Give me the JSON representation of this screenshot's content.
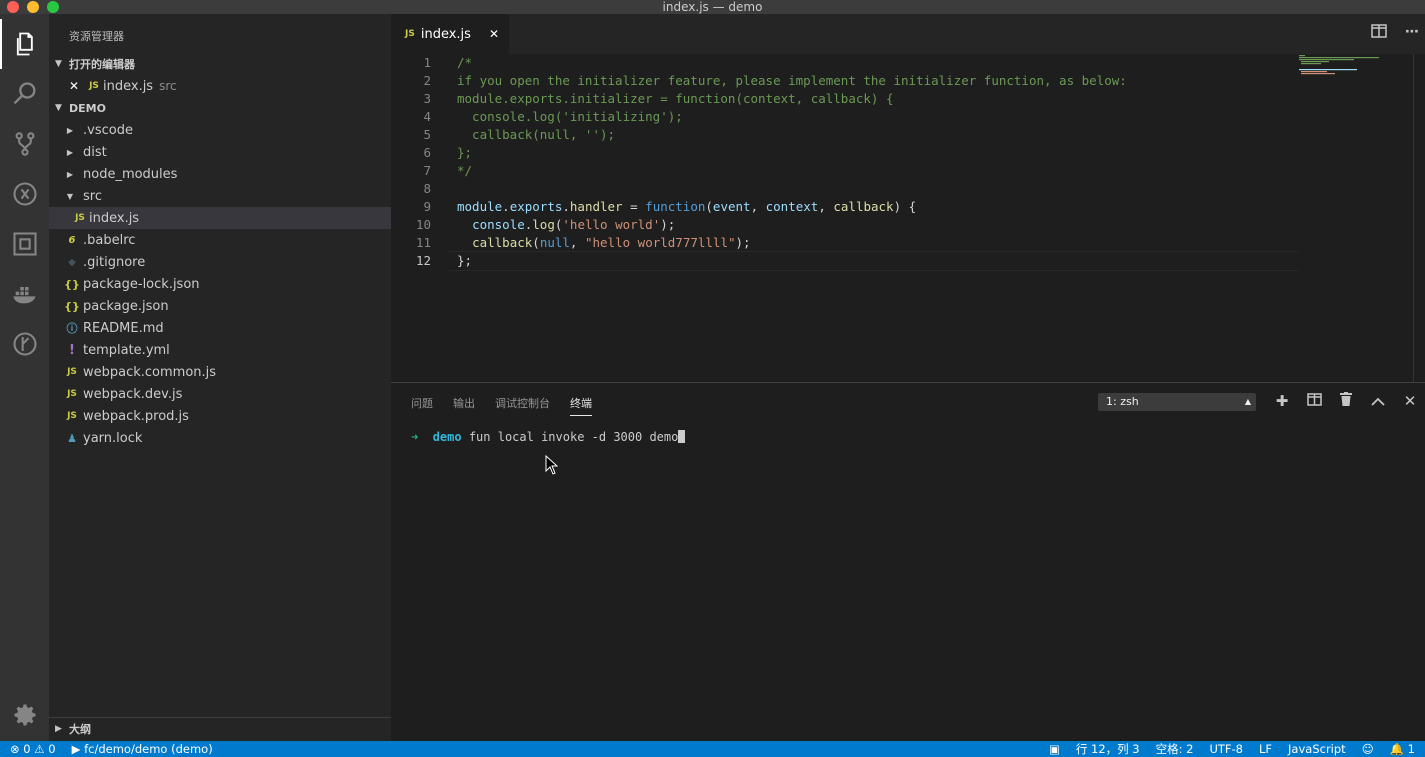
{
  "window": {
    "title": "index.js — demo"
  },
  "sidebar": {
    "title": "资源管理器",
    "open_editors": {
      "header": "打开的编辑器",
      "items": [
        {
          "name": "index.js",
          "path": "src"
        }
      ]
    },
    "project": {
      "header": "DEMO",
      "items": [
        {
          "label": ".vscode",
          "type": "folder"
        },
        {
          "label": "dist",
          "type": "folder"
        },
        {
          "label": "node_modules",
          "type": "folder"
        },
        {
          "label": "src",
          "type": "folder-open"
        },
        {
          "label": "index.js",
          "type": "js"
        },
        {
          "label": ".babelrc",
          "type": "babel"
        },
        {
          "label": ".gitignore",
          "type": "git"
        },
        {
          "label": "package-lock.json",
          "type": "json"
        },
        {
          "label": "package.json",
          "type": "json"
        },
        {
          "label": "README.md",
          "type": "info"
        },
        {
          "label": "template.yml",
          "type": "yml"
        },
        {
          "label": "webpack.common.js",
          "type": "js"
        },
        {
          "label": "webpack.dev.js",
          "type": "js"
        },
        {
          "label": "webpack.prod.js",
          "type": "js"
        },
        {
          "label": "yarn.lock",
          "type": "yarn"
        }
      ]
    },
    "outline": {
      "header": "大纲"
    }
  },
  "editor": {
    "tab": {
      "icon": "JS",
      "label": "index.js",
      "close": "✕"
    },
    "line_numbers": [
      "1",
      "2",
      "3",
      "4",
      "5",
      "6",
      "7",
      "8",
      "9",
      "10",
      "11",
      "12"
    ],
    "lines": [
      "/*",
      "if you open the initializer feature, please implement the initializer function, as below:",
      "module.exports.initializer = function(context, callback) {",
      "  console.log('initializing');",
      "  callback(null, '');",
      "};",
      "*/",
      "",
      "module.exports.handler = function(event, context, callback) {",
      "  console.log('hello world');",
      "  callback(null, \"hello world777llll\");",
      "};"
    ]
  },
  "panel": {
    "tabs": [
      "问题",
      "输出",
      "调试控制台",
      "终端"
    ],
    "terminal_select": "1: zsh",
    "terminal": {
      "arrow": "➜",
      "dir": "demo",
      "command": "fun local invoke -d 3000 demo"
    }
  },
  "statusbar": {
    "errors": "0",
    "warnings": "0",
    "path": "fc/demo/demo (demo)",
    "position": "行 12，列 3",
    "spaces": "空格: 2",
    "encoding": "UTF-8",
    "eol": "LF",
    "language": "JavaScript",
    "notifications": "1"
  }
}
